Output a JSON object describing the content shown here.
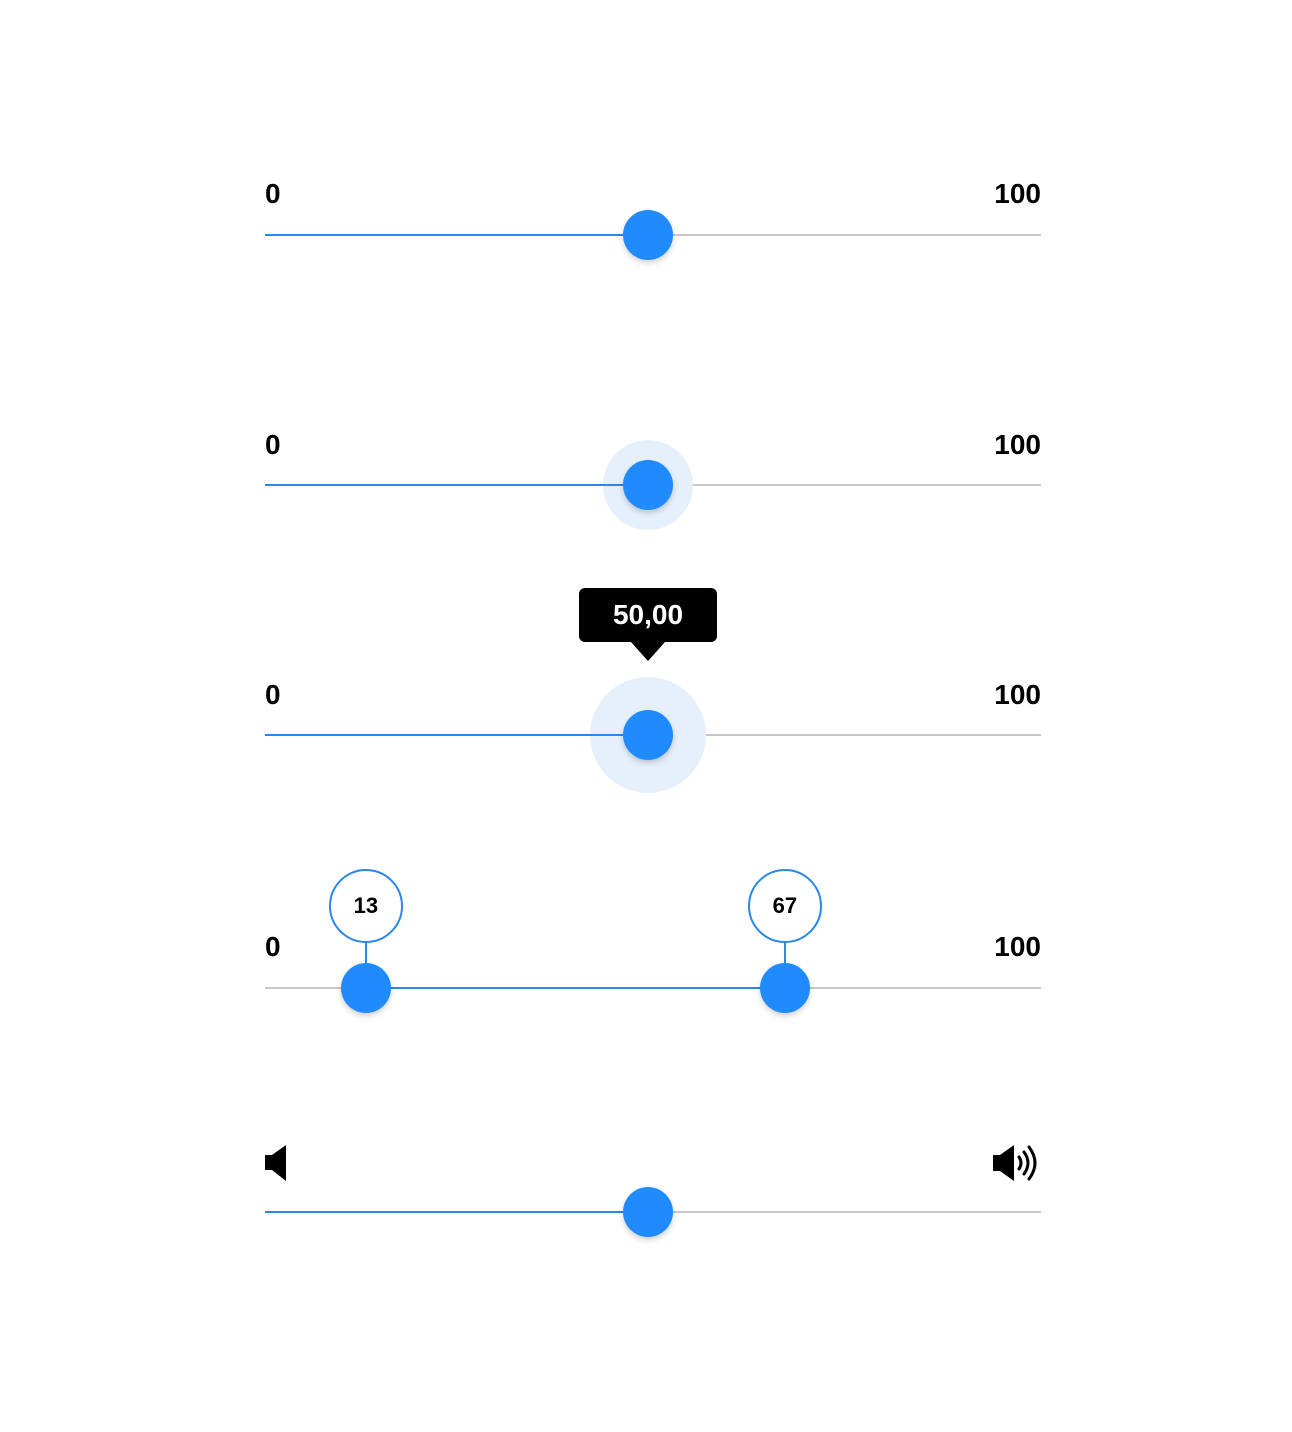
{
  "sliders": [
    {
      "id": "basic",
      "min_label": "0",
      "max_label": "100",
      "value_percent": 49.4,
      "state": "default"
    },
    {
      "id": "hover",
      "min_label": "0",
      "max_label": "100",
      "value_percent": 49.4,
      "state": "hover"
    },
    {
      "id": "tooltip",
      "min_label": "0",
      "max_label": "100",
      "value_percent": 49.4,
      "state": "active",
      "tooltip_text": "50,00"
    },
    {
      "id": "range",
      "min_label": "0",
      "max_label": "100",
      "low_value": 13,
      "high_value": 67,
      "low_label": "13",
      "high_label": "67"
    },
    {
      "id": "volume",
      "min_icon": "volume-mute-icon",
      "max_icon": "volume-up-icon",
      "value_percent": 49.4,
      "state": "default"
    }
  ],
  "colors": {
    "accent": "#1f8bff",
    "fill": "#2b87e8",
    "track": "#c8c8c8",
    "halo": "#e6f0fb",
    "tooltip_bg": "#000000"
  }
}
